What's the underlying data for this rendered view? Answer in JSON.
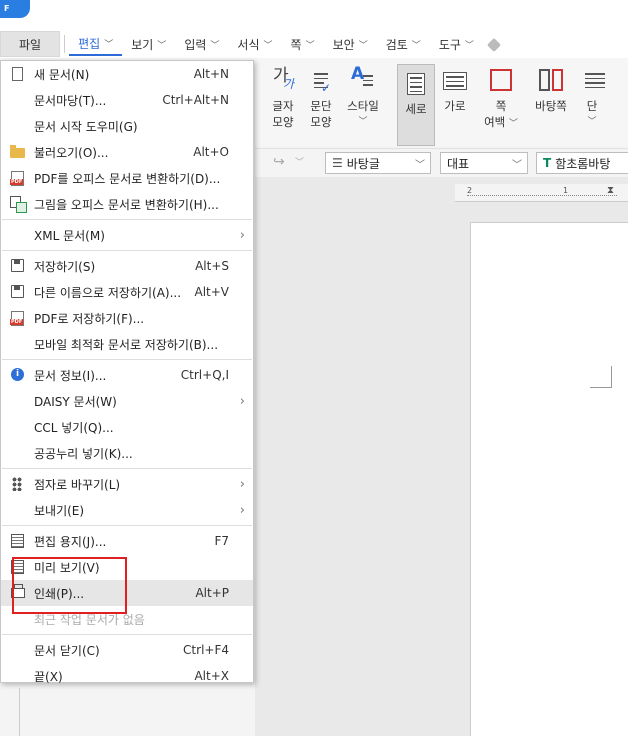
{
  "menubar": {
    "items": [
      {
        "label": "파일",
        "chevron": false
      },
      {
        "label": "편집",
        "chevron": true
      },
      {
        "label": "보기",
        "chevron": true
      },
      {
        "label": "입력",
        "chevron": true
      },
      {
        "label": "서식",
        "chevron": true
      },
      {
        "label": "쪽",
        "chevron": true
      },
      {
        "label": "보안",
        "chevron": true
      },
      {
        "label": "검토",
        "chevron": true
      },
      {
        "label": "도구",
        "chevron": true
      }
    ]
  },
  "ribbon": {
    "char_shape": {
      "line1": "글자",
      "line2": "모양"
    },
    "para_shape": {
      "line1": "문단",
      "line2": "모양"
    },
    "style": {
      "line1": "스타일"
    },
    "vertical": {
      "line1": "세로"
    },
    "horizontal": {
      "line1": "가로"
    },
    "page_margin": {
      "line1": "쪽",
      "line2": "여백"
    },
    "page_bg": {
      "line1": "바탕쪽"
    },
    "columns": {
      "line1": "단"
    }
  },
  "toolbar": {
    "style_select": "바탕글",
    "lang_select": "대표",
    "font_select": "함초롬바탕"
  },
  "file_menu": {
    "groups": [
      [
        {
          "icon": "new-doc-icon",
          "label": "새 문서(N)",
          "shortcut": "Alt+N",
          "submenu": false
        },
        {
          "icon": "",
          "label": "문서마당(T)...",
          "shortcut": "Ctrl+Alt+N",
          "submenu": false
        },
        {
          "icon": "",
          "label": "문서 시작 도우미(G)",
          "shortcut": "",
          "submenu": false
        },
        {
          "icon": "folder-open-icon",
          "label": "불러오기(O)...",
          "shortcut": "Alt+O",
          "submenu": false
        },
        {
          "icon": "pdf-icon",
          "label": "PDF를 오피스 문서로 변환하기(D)...",
          "shortcut": "",
          "submenu": false
        },
        {
          "icon": "image-convert-icon",
          "label": "그림을 오피스 문서로 변환하기(H)...",
          "shortcut": "",
          "submenu": false
        }
      ],
      [
        {
          "icon": "",
          "label": "XML 문서(M)",
          "shortcut": "",
          "submenu": true
        }
      ],
      [
        {
          "icon": "save-icon",
          "label": "저장하기(S)",
          "shortcut": "Alt+S",
          "submenu": false
        },
        {
          "icon": "save-as-icon",
          "label": "다른 이름으로 저장하기(A)...",
          "shortcut": "Alt+V",
          "submenu": false
        },
        {
          "icon": "pdf-save-icon",
          "label": "PDF로 저장하기(F)...",
          "shortcut": "",
          "submenu": false
        },
        {
          "icon": "",
          "label": "모바일 최적화 문서로 저장하기(B)...",
          "shortcut": "",
          "submenu": false
        }
      ],
      [
        {
          "icon": "info-icon",
          "label": "문서 정보(I)...",
          "shortcut": "Ctrl+Q,I",
          "submenu": false
        },
        {
          "icon": "",
          "label": "DAISY 문서(W)",
          "shortcut": "",
          "submenu": true
        },
        {
          "icon": "",
          "label": "CCL 넣기(Q)...",
          "shortcut": "",
          "submenu": false
        },
        {
          "icon": "",
          "label": "공공누리 넣기(K)...",
          "shortcut": "",
          "submenu": false
        }
      ],
      [
        {
          "icon": "braille-icon",
          "label": "점자로 바꾸기(L)",
          "shortcut": "",
          "submenu": true
        },
        {
          "icon": "",
          "label": "보내기(E)",
          "shortcut": "",
          "submenu": true
        }
      ],
      [
        {
          "icon": "edit-paper-icon",
          "label": "편집 용지(J)...",
          "shortcut": "F7",
          "submenu": false
        },
        {
          "icon": "preview-icon",
          "label": "미리 보기(V)",
          "shortcut": "",
          "submenu": false
        },
        {
          "icon": "printer-icon",
          "label": "인쇄(P)...",
          "shortcut": "Alt+P",
          "submenu": false,
          "highlight": true
        },
        {
          "icon": "",
          "label": "최근 작업 문서가 없음",
          "shortcut": "",
          "submenu": false,
          "disabled": true
        }
      ],
      [
        {
          "icon": "",
          "label": "문서 닫기(C)",
          "shortcut": "Ctrl+F4",
          "submenu": false
        },
        {
          "icon": "",
          "label": "끝(X)",
          "shortcut": "Alt+X",
          "submenu": false
        }
      ]
    ]
  },
  "ruler": {
    "marks": [
      "2",
      "1"
    ]
  },
  "colors": {
    "accent": "#2c6ad8",
    "highlight_box": "#e0201f",
    "menu_hover": "#e6e6e6"
  }
}
